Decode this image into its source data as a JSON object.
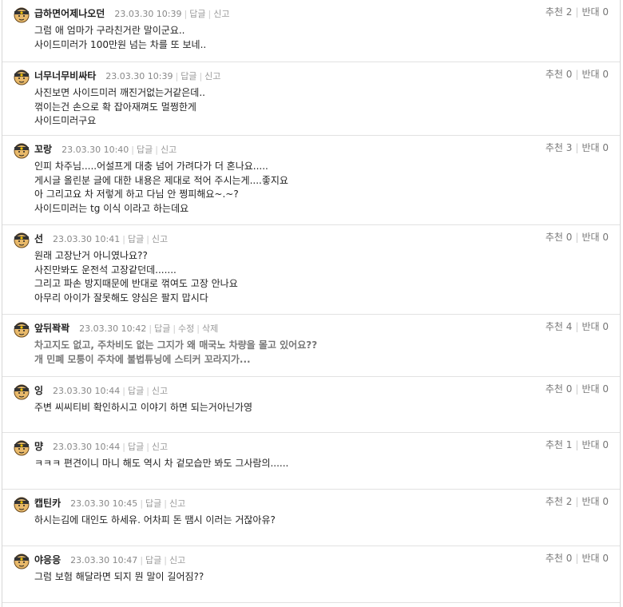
{
  "comments": [
    {
      "nick": "급하면어제나오던",
      "date": "23.03.30 10:39",
      "actions": [
        "답글",
        "신고"
      ],
      "up_label": "추천",
      "up": "2",
      "down_label": "반대",
      "down": "0",
      "bold": false,
      "lines": [
        "그럼 애 엄마가 구라친거란 말이군요..",
        "사이드미러가 100만원 넘는 차를 또 보네.."
      ]
    },
    {
      "nick": "너무너무비싸타",
      "date": "23.03.30 10:39",
      "actions": [
        "답글",
        "신고"
      ],
      "up_label": "추천",
      "up": "0",
      "down_label": "반대",
      "down": "0",
      "bold": false,
      "lines": [
        "사진보면 사이드미러 깨진거없는거같은데..",
        "꺾이는건 손으로 확 잡아재껴도 멀쩡한게",
        "사이드미러구요"
      ]
    },
    {
      "nick": "꼬랑",
      "date": "23.03.30 10:40",
      "actions": [
        "답글",
        "신고"
      ],
      "up_label": "추천",
      "up": "3",
      "down_label": "반대",
      "down": "0",
      "bold": false,
      "lines": [
        "인피 차주님.....어설프게 대충 넘어 가려다가 더 혼나요.....",
        "게시글 올린분 글에 대한 내용은 제대로 적어 주시는게....좋지요",
        "아 그리고요 차 저렇게 하고 다님 안 쩡피해요~.~?",
        "사이드미러는 tg 이식 이라고 하는데요"
      ]
    },
    {
      "nick": "선",
      "date": "23.03.30 10:41",
      "actions": [
        "답글",
        "신고"
      ],
      "up_label": "추천",
      "up": "0",
      "down_label": "반대",
      "down": "0",
      "bold": false,
      "lines": [
        "원래 고장난거 아니였나요??",
        "사진만봐도 운전석 고장같던데.......",
        "그리고 파손 방지때문에 반대로 꺾여도 고장 안나요",
        "아무리 아이가 잘못해도 양심은 팔지 맙시다"
      ]
    },
    {
      "nick": "앞뒤꽉꽉",
      "date": "23.03.30 10:42",
      "actions": [
        "답글",
        "수정",
        "삭제"
      ],
      "up_label": "추천",
      "up": "4",
      "down_label": "반대",
      "down": "0",
      "bold": true,
      "lines": [
        "차고지도 없고, 주차비도 없는 그지가 왜 매국노 차량을 몰고 있어요??",
        "개 민폐 모퉁이 주차에 불법튜닝에 스티커 꼬라지가..."
      ]
    },
    {
      "nick": "잉",
      "date": "23.03.30 10:44",
      "actions": [
        "답글",
        "신고"
      ],
      "up_label": "추천",
      "up": "0",
      "down_label": "반대",
      "down": "0",
      "bold": false,
      "lines": [
        "주변 씨씨티비 확인하시고 이야기 하면 되는거아닌가영"
      ]
    },
    {
      "nick": "먕",
      "date": "23.03.30 10:44",
      "actions": [
        "답글",
        "신고"
      ],
      "up_label": "추천",
      "up": "1",
      "down_label": "반대",
      "down": "0",
      "bold": false,
      "lines": [
        "ㅋㅋㅋ 편견이니 마니 해도 역시 차 겉모습만 봐도 그사람의......"
      ]
    },
    {
      "nick": "캡틴카",
      "date": "23.03.30 10:45",
      "actions": [
        "답글",
        "신고"
      ],
      "up_label": "추천",
      "up": "2",
      "down_label": "반대",
      "down": "0",
      "bold": false,
      "lines": [
        "하시는김에 대인도 하세유. 어차피 돈 땜시 이러는 거잖아유?"
      ]
    },
    {
      "nick": "야응응",
      "date": "23.03.30 10:47",
      "actions": [
        "답글",
        "신고"
      ],
      "up_label": "추천",
      "up": "0",
      "down_label": "반대",
      "down": "0",
      "bold": false,
      "lines": [
        "그럼 보험 해달라면 되지 뭔 말이 길어짐??"
      ]
    }
  ],
  "colors": {
    "avatar_face": "#e8b96a",
    "avatar_helmet": "#333333",
    "avatar_star": "#f2c200"
  }
}
